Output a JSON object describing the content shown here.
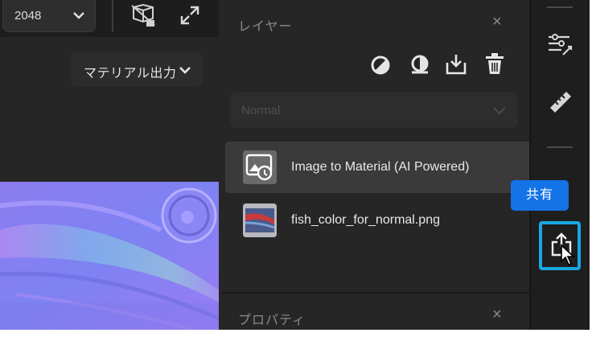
{
  "toolbar": {
    "resolution_value": "2048",
    "output_menu_label": "マテリアル出力"
  },
  "layers_panel": {
    "title": "レイヤー",
    "close_glyph": "×",
    "blend_mode_value": "Normal",
    "layers": [
      {
        "name": "Image to Material (AI Powered)",
        "selected": true
      },
      {
        "name": "fish_color_for_normal.png",
        "selected": false
      }
    ]
  },
  "properties_panel": {
    "title": "プロパティ",
    "close_glyph": "×"
  },
  "right_sidebar": {
    "share_tooltip": "共有"
  },
  "colors": {
    "accent_blue": "#1473e6",
    "highlight_cyan": "#19a7e0",
    "panel_bg": "#262626",
    "selected_row": "#3a3a3a"
  },
  "icons": [
    "chevron-down-icon",
    "3d-cube-icon",
    "expand-icon",
    "mask-icon",
    "fill-layer-icon",
    "import-icon",
    "trash-icon",
    "adjust-sliders-icon",
    "ruler-icon",
    "share-icon",
    "cursor-icon",
    "close-icon"
  ]
}
